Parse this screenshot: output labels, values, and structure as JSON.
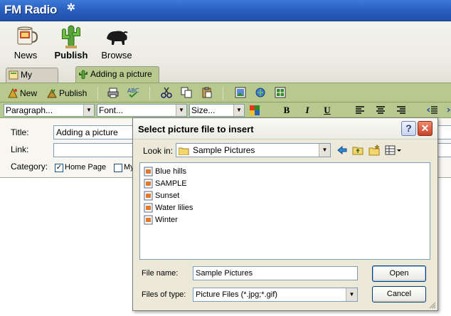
{
  "app": {
    "title": "FM Radio",
    "sparkle": "✲"
  },
  "nav": {
    "items": [
      {
        "label": "News"
      },
      {
        "label": "Publish"
      },
      {
        "label": "Browse"
      }
    ]
  },
  "doc_tabs": [
    {
      "label": "My Posts"
    },
    {
      "label": "Adding a picture"
    }
  ],
  "toolbar": {
    "new_label": "New",
    "publish_label": "Publish",
    "paragraph": "Paragraph...",
    "font": "Font...",
    "size": "Size...",
    "bold": "B",
    "italic": "I",
    "underline": "U"
  },
  "form": {
    "title_label": "Title:",
    "title_value": "Adding a picture",
    "link_label": "Link:",
    "link_value": "",
    "category_label": "Category:",
    "categories": [
      {
        "label": "Home Page",
        "checked": true
      },
      {
        "label": "My",
        "checked": false
      }
    ]
  },
  "dialog": {
    "title": "Select picture file to insert",
    "help": "?",
    "close": "✕",
    "look_in_label": "Look in:",
    "look_in_value": "Sample Pictures",
    "files": [
      "Blue hills",
      "SAMPLE",
      "Sunset",
      "Water lilies",
      "Winter"
    ],
    "file_name_label": "File name:",
    "file_name_value": "Sample Pictures",
    "file_type_label": "Files of type:",
    "file_type_value": "Picture Files (*.jpg;*.gif)",
    "open_label": "Open",
    "cancel_label": "Cancel"
  },
  "colors": {
    "titlebar": "#2a5fbf",
    "toolbar": "#b7c98e",
    "close": "#c84228"
  }
}
